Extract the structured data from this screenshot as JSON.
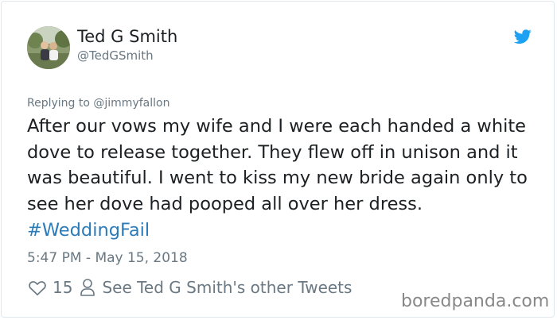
{
  "tweet": {
    "author_name": "Ted G Smith",
    "author_handle": "@TedGSmith",
    "reply_prefix": "Replying to",
    "reply_to": "@jimmyfallon",
    "text_main": "After our vows my wife and I were each handed a white dove to release together. They flew off in unison and it was beautiful. I went to kiss my new bride again only to see her dove had pooped all over her dress.",
    "hashtag": "#WeddingFail",
    "timestamp": "5:47 PM - May 15, 2018",
    "like_count": "15",
    "other_tweets_label": "See Ted G Smith's other Tweets"
  },
  "icons": {
    "brand": "twitter-bird-icon",
    "like": "heart-icon",
    "profile": "person-icon"
  },
  "colors": {
    "link": "#2b7bb9",
    "twitter_blue": "#1da1f2",
    "secondary_text": "#697882",
    "primary_text": "#1c2022"
  },
  "watermark": "boredpanda.com"
}
